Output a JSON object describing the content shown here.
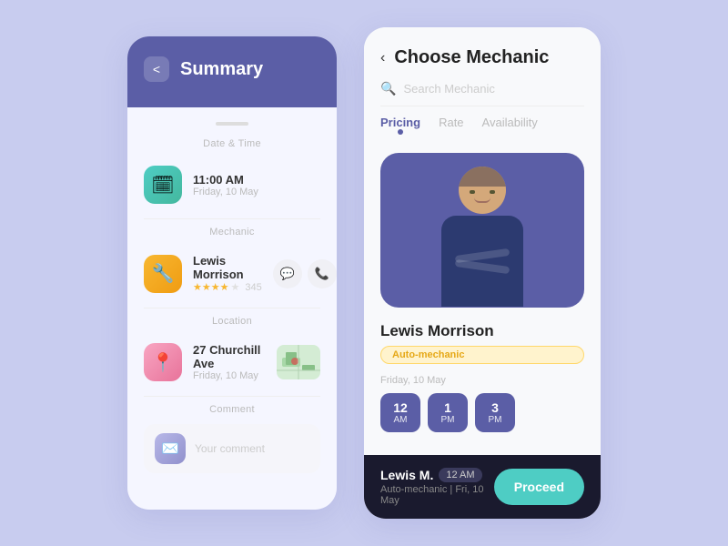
{
  "summary": {
    "title": "Summary",
    "back_label": "<",
    "sections": {
      "datetime": {
        "label": "Date & Time",
        "time": "11:00 AM",
        "date": "Friday, 10 May"
      },
      "mechanic": {
        "label": "Mechanic",
        "name": "Lewis Morrison",
        "stars": 4,
        "rating": "345"
      },
      "location": {
        "label": "Location",
        "address": "27 Churchill Ave",
        "date": "Friday, 10 May"
      },
      "comment": {
        "label": "Comment",
        "placeholder": "Your comment"
      }
    }
  },
  "mechanic_chooser": {
    "title": "Choose Mechanic",
    "back_label": "<",
    "search_placeholder": "Search Mechanic",
    "tabs": [
      {
        "label": "Pricing",
        "active": true
      },
      {
        "label": "Rate",
        "active": false
      },
      {
        "label": "Availability",
        "active": false
      }
    ],
    "mechanic": {
      "name": "Lewis Morrison",
      "badge": "Auto-mechanic",
      "availability_label": "Friday, 10 May",
      "time_slots": [
        {
          "hour": "12",
          "period": "AM"
        },
        {
          "hour": "1",
          "period": "PM"
        },
        {
          "hour": "3",
          "period": "PM"
        }
      ]
    },
    "bottom_bar": {
      "name": "Lewis M.",
      "time_badge": "12 AM",
      "sub": "Auto-mechanic  |  Fri, 10 May",
      "proceed_label": "Proceed"
    }
  }
}
